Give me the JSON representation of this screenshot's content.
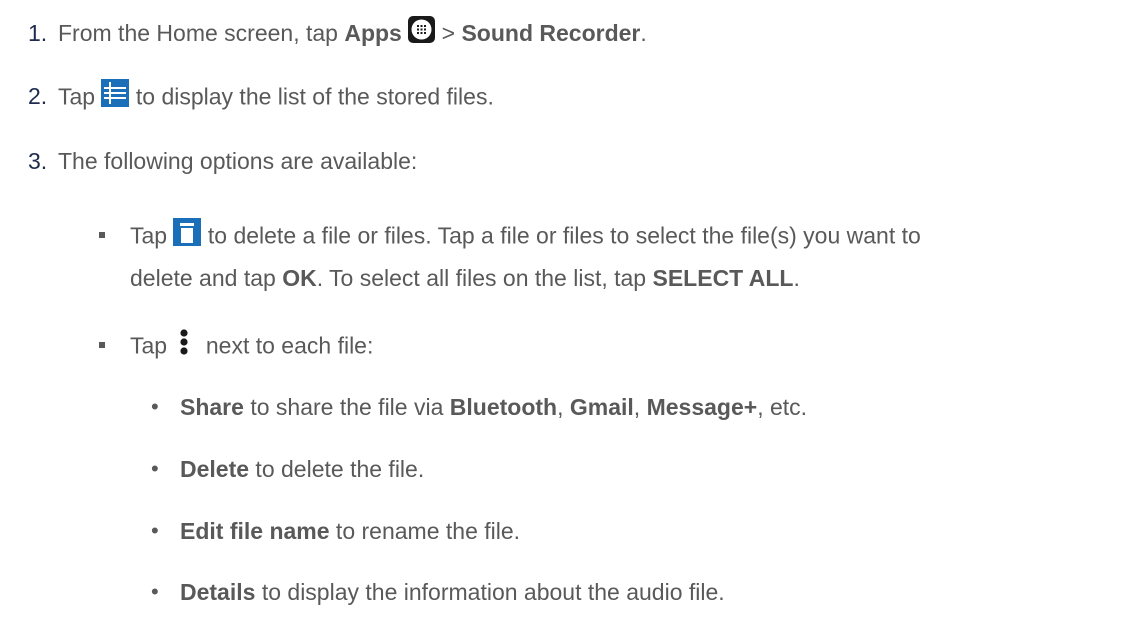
{
  "steps": [
    {
      "number": "1.",
      "t1": "From the Home screen, tap ",
      "b1": "Apps",
      "t2": " > ",
      "b2": "Sound Recorder",
      "t3": ".",
      "icon": "apps-grid-icon"
    },
    {
      "number": "2.",
      "t1": "Tap ",
      "t2": " to display the list of the stored files.",
      "icon": "list-icon"
    },
    {
      "number": "3.",
      "t1": "The following options are available:"
    }
  ],
  "options": [
    {
      "line1": {
        "t1": "Tap ",
        "t2": " to delete a file or files. Tap a file or files to select the file(s) you want to"
      },
      "line2": {
        "t1": "delete and tap ",
        "b1": "OK",
        "t2": ". To select all files on the list, tap ",
        "b2": "SELECT ALL",
        "t3": "."
      },
      "icon": "trash-icon"
    },
    {
      "line1": {
        "t1": "Tap ",
        "t2": " next to each file:"
      },
      "icon": "more-vertical-icon"
    }
  ],
  "file_actions": [
    {
      "b1": "Share",
      "t1": " to share the file via ",
      "b2": "Bluetooth",
      "t2": ", ",
      "b3": "Gmail",
      "t3": ", ",
      "b4": "Message+",
      "t4": ", etc."
    },
    {
      "b1": "Delete",
      "t1": " to delete the file."
    },
    {
      "b1": "Edit file name",
      "t1": " to rename the file."
    },
    {
      "b1": "Details",
      "t1": " to display the information about the audio file."
    }
  ],
  "bullet_char": "•",
  "colors": {
    "text": "#595959",
    "step_number": "#1f2b4d",
    "icon_blue": "#1a6fb8",
    "icon_dark": "#1a1a1a"
  }
}
